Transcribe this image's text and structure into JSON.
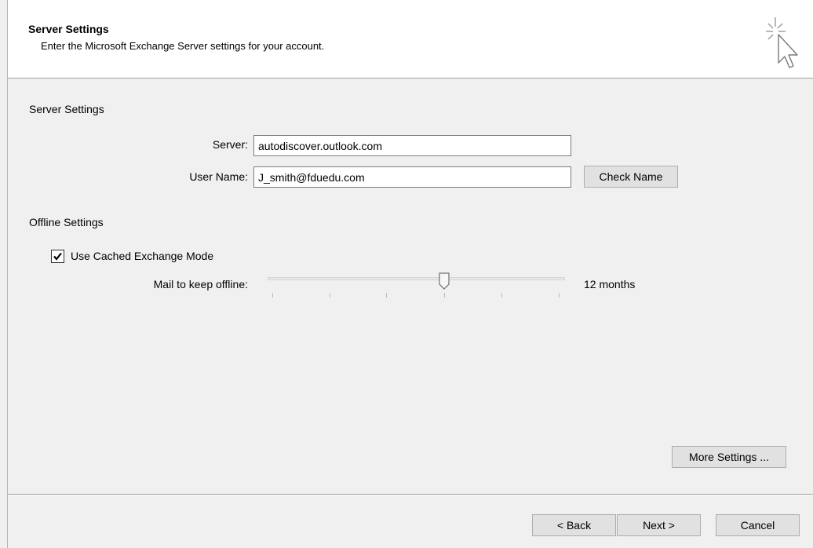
{
  "header": {
    "title": "Server Settings",
    "subtitle": "Enter the Microsoft Exchange Server settings for your account.",
    "icon": "wizard-cursor-icon"
  },
  "server_section": {
    "heading": "Server Settings",
    "server_label": "Server:",
    "server_value": "autodiscover.outlook.com",
    "username_label": "User Name:",
    "username_value": "J_smith@fduedu.com",
    "check_name_label": "Check Name"
  },
  "offline_section": {
    "heading": "Offline Settings",
    "cached_mode_label": "Use Cached Exchange Mode",
    "cached_mode_checked": true,
    "mail_offline_label": "Mail to keep offline:",
    "mail_offline_value": "12 months",
    "slider_position_index": 3,
    "slider_tick_count": 6
  },
  "buttons": {
    "more_settings": "More Settings ...",
    "back": "< Back",
    "next": "Next >",
    "cancel": "Cancel"
  }
}
